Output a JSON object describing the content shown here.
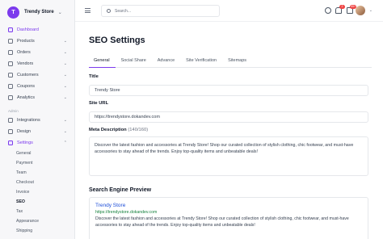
{
  "store": {
    "initial": "T",
    "name": "Trendy Store"
  },
  "sidebar": {
    "items": [
      {
        "label": "Dashboard",
        "icon": "grid-icon",
        "active": true
      },
      {
        "label": "Products",
        "icon": "box-icon",
        "expand": true
      },
      {
        "label": "Orders",
        "icon": "cart-icon",
        "expand": true
      },
      {
        "label": "Vendors",
        "icon": "store-icon",
        "expand": true
      },
      {
        "label": "Customers",
        "icon": "users-icon",
        "expand": true
      },
      {
        "label": "Coupons",
        "icon": "ticket-icon",
        "expand": true
      },
      {
        "label": "Analytics",
        "icon": "chart-icon",
        "expand": true
      }
    ],
    "admin_label": "Admin",
    "admin_items": [
      {
        "label": "Integrations",
        "icon": "plug-icon",
        "expand": true
      },
      {
        "label": "Design",
        "icon": "brush-icon",
        "expand": true
      },
      {
        "label": "Settings",
        "icon": "gear-icon",
        "expand": true,
        "active": true
      }
    ],
    "settings_sub": [
      "General",
      "Payment",
      "Team",
      "Checkout",
      "Invoice",
      "SEO",
      "Tax",
      "Appearance",
      "Shipping"
    ],
    "settings_active": "SEO"
  },
  "topbar": {
    "search_placeholder": "Search...",
    "notification_count": "2",
    "mail_count": "99+",
    "icons": [
      "help-icon",
      "bell-icon",
      "mail-icon"
    ]
  },
  "page": {
    "title": "SEO Settings",
    "tabs": [
      "General",
      "Social Share",
      "Advance",
      "Site Verification",
      "Sitemaps"
    ],
    "active_tab": "General",
    "title_label": "Title",
    "title_value": "Trendy Store",
    "url_label": "Site URL",
    "url_value": "https://trendystore.dokandev.com",
    "meta_label": "Meta Description",
    "meta_count": "(140/160)",
    "meta_value": "Discover the latest fashion and accessories at Trendy Store! Shop our curated collection of stylish clothing, chic footwear, and must-have accessories to stay ahead of the trends. Enjoy top-quality items and unbeatable deals!",
    "preview_heading": "Search Engine Preview",
    "preview_title": "Trendy Store",
    "preview_url": "https://trendystore.dokandev.com",
    "preview_desc": "Discover the latest fashion and accessories at Trendy Store! Shop our curated collection of stylish clothing, chic footwear, and must-have accessories to stay ahead of the trends. Enjoy top-quality items and unbeatable deals!"
  },
  "colors": {
    "accent": "#7c3aed",
    "link": "#1d4ed8",
    "url": "#15803d",
    "badge": "#ef4444"
  }
}
